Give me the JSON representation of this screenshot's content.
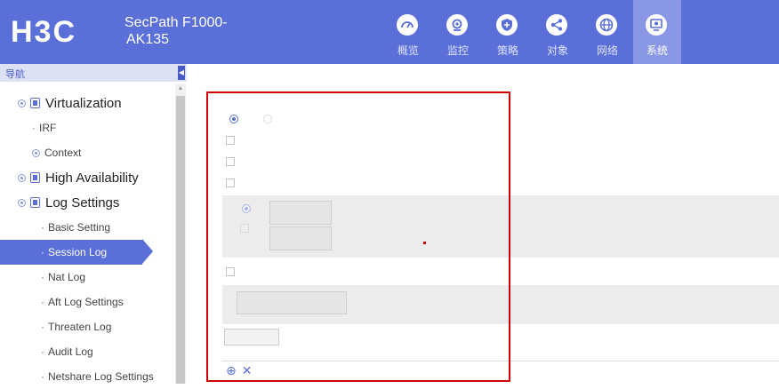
{
  "header": {
    "logo": "H3C",
    "product_line1": "SecPath F1000-",
    "product_line2": "AK135",
    "nav": [
      {
        "label": "概览",
        "icon": "gauge-icon"
      },
      {
        "label": "监控",
        "icon": "monitor-eye-icon"
      },
      {
        "label": "策略",
        "icon": "shield-plus-icon"
      },
      {
        "label": "对象",
        "icon": "share-nodes-icon"
      },
      {
        "label": "网络",
        "icon": "globe-icon"
      },
      {
        "label": "系统",
        "icon": "system-display-icon",
        "active": true
      }
    ]
  },
  "sidebar": {
    "title": "导航",
    "items": [
      {
        "label": "Virtualization",
        "level": 1
      },
      {
        "label": "IRF",
        "level": 2
      },
      {
        "label": "Context",
        "level": 2
      },
      {
        "label": "High Availability",
        "level": 1
      },
      {
        "label": "Log Settings",
        "level": 1
      },
      {
        "label": "Basic Setting",
        "level": 2
      },
      {
        "label": "Session Log",
        "level": 2,
        "selected": true
      },
      {
        "label": "Nat Log",
        "level": 2
      },
      {
        "label": "Aft Log Settings",
        "level": 2
      },
      {
        "label": "Threaten Log",
        "level": 2
      },
      {
        "label": "Audit Log",
        "level": 2
      },
      {
        "label": "Netshare Log Settings",
        "level": 2
      }
    ]
  },
  "colors": {
    "brand": "#5b6fd9",
    "nav_active": "#8a97e4",
    "highlight_box": "#d00000"
  },
  "toolbar": {
    "add_symbol": "⊕",
    "delete_symbol": "✕"
  }
}
